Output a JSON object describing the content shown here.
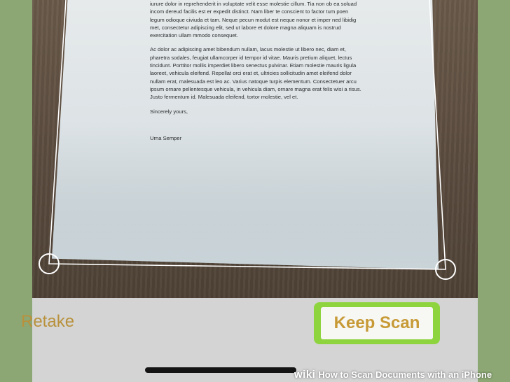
{
  "letter": {
    "para1_lines": [
      "iurure dolor in reprehenderit in voluptate velit esse molestie cillum. Tia non ob ea soluad",
      "incom dereud facilis est er expedit distinct. Nam liber te conscient to factor tum poen",
      "legum odioque civiuda et tam. Neque pecun modut est neque nonor et imper ned libidig",
      "met, consectetur adipiscing elit, sed ut labore et dolore magna aliquam is nostrud",
      "exercitation ullam mmodo consequet."
    ],
    "para2_lines": [
      "Ac dolor ac adipiscing amet bibendum nullam, lacus molestie ut libero nec, diam et,",
      "pharetra sodales, feugiat ullamcorper id tempor id vitae. Mauris pretium aliquet, lectus",
      "tincidunt. Porttitor mollis imperdiet libero senectus pulvinar. Etiam molestie mauris ligula",
      "laoreet, vehicula eleifend. Repellat orci erat et, ultricies sollicitudin amet eleifend dolor",
      "nullam erat, malesuada est leo ac. Varius natoque turpis elementum. Consectetuer arcu",
      "ipsum ornare pellentesque vehicula, in vehicula diam, ornare magna erat felis wisi a risus.",
      "Justo fermentum id. Malesuada eleifend, tortor molestie, vel et."
    ],
    "closing": "Sincerely yours,",
    "signature": "Urna Semper"
  },
  "controls": {
    "retake_label": "Retake",
    "keep_scan_label": "Keep Scan"
  },
  "caption": {
    "brand": "wiki",
    "title": "How to Scan Documents with an iPhone"
  },
  "colors": {
    "accent_text": "#c79a36",
    "highlight": "#8ed43e",
    "background": "#8aa672"
  }
}
